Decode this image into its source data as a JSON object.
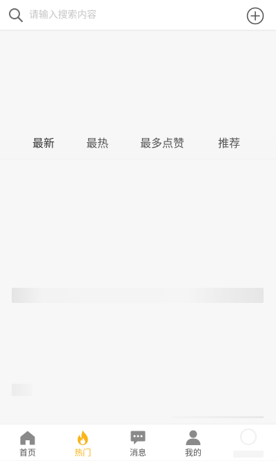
{
  "search": {
    "placeholder": "请输入搜索内容",
    "icon": "search-icon",
    "add_icon": "plus-circle-icon"
  },
  "sort_tabs": [
    {
      "label": "最新",
      "active": true
    },
    {
      "label": "最热",
      "active": false
    },
    {
      "label": "最多点赞",
      "active": false
    },
    {
      "label": "推荐",
      "active": false
    }
  ],
  "tab_bar": {
    "items": [
      {
        "label": "首页",
        "icon": "home-icon",
        "active": false
      },
      {
        "label": "热门",
        "icon": "flame-icon",
        "active": true
      },
      {
        "label": "消息",
        "icon": "message-icon",
        "active": false
      },
      {
        "label": "我的",
        "icon": "user-icon",
        "active": false
      }
    ]
  },
  "colors": {
    "accent": "#f8b51b",
    "icon_gray": "#8a8a8a",
    "text": "#555555",
    "background": "#f7f7f7"
  }
}
